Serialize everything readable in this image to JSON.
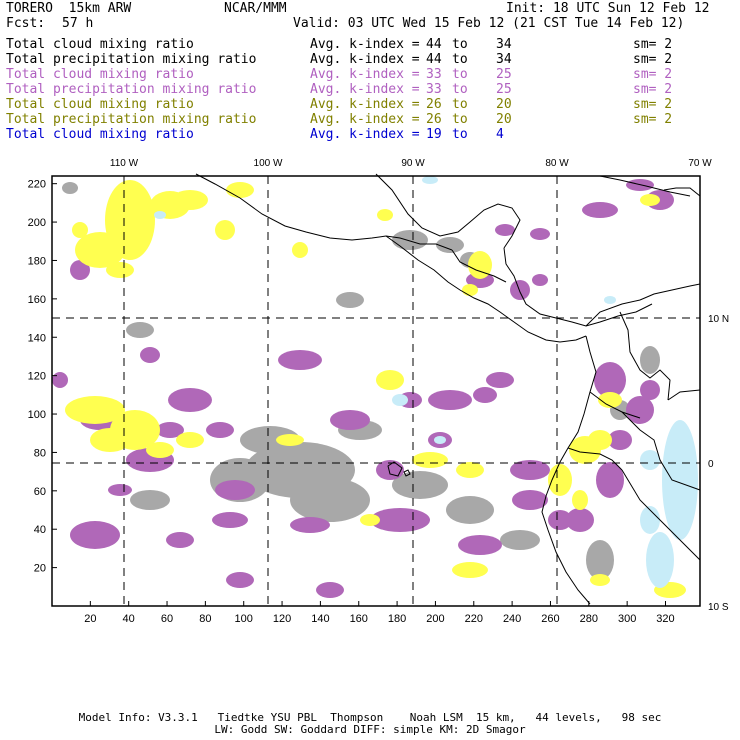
{
  "header": {
    "model": "TORERO  15km ARW",
    "center": "NCAR/MMM",
    "init": "Init: 18 UTC Sun 12 Feb 12",
    "fcst_label": "Fcst:",
    "fcst_value": "57 h",
    "valid": "Valid: 03 UTC Wed 15 Feb 12 (21 CST Tue 14 Feb 12)"
  },
  "legend": [
    {
      "field": "Total cloud mixing ratio",
      "kindex": "Avg. k-index =",
      "from": "44",
      "to_word": "to",
      "to": "34",
      "sm": "sm= 2",
      "color": "#000000"
    },
    {
      "field": "Total precipitation mixing ratio",
      "kindex": "Avg. k-index =",
      "from": "44",
      "to_word": "to",
      "to": "34",
      "sm": "sm= 2",
      "color": "#000000"
    },
    {
      "field": "Total cloud mixing ratio",
      "kindex": "Avg. k-index =",
      "from": "33",
      "to_word": "to",
      "to": "25",
      "sm": "sm= 2",
      "color": "#b060c0"
    },
    {
      "field": "Total precipitation mixing ratio",
      "kindex": "Avg. k-index =",
      "from": "33",
      "to_word": "to",
      "to": "25",
      "sm": "sm= 2",
      "color": "#b060c0"
    },
    {
      "field": "Total cloud mixing ratio",
      "kindex": "Avg. k-index =",
      "from": "26",
      "to_word": "to",
      "to": "20",
      "sm": "sm= 2",
      "color": "#808000"
    },
    {
      "field": "Total precipitation mixing ratio",
      "kindex": "Avg. k-index =",
      "from": "26",
      "to_word": "to",
      "to": "20",
      "sm": "sm= 2",
      "color": "#808000"
    },
    {
      "field": "Total cloud mixing ratio",
      "kindex": "Avg. k-index =",
      "from": "19",
      "to_word": "to",
      "to": "4",
      "sm": "",
      "color": "#0000d0"
    }
  ],
  "map": {
    "lon_labels": [
      "110 W",
      "100 W",
      "90 W",
      "80 W",
      "70 W"
    ],
    "lat_labels": [
      "10 N",
      "0",
      "10 S"
    ],
    "x_ticks": [
      "20",
      "40",
      "60",
      "80",
      "100",
      "120",
      "140",
      "160",
      "180",
      "200",
      "220",
      "240",
      "260",
      "280",
      "300",
      "320"
    ],
    "y_ticks": [
      "20",
      "40",
      "60",
      "80",
      "100",
      "120",
      "140",
      "160",
      "180",
      "200",
      "220"
    ],
    "fill_colors": {
      "gray": "#a8a8a8",
      "purple": "#b068b8",
      "yellow": "#ffff50",
      "lightblue": "#c8ecf8"
    }
  },
  "footer": {
    "line1": "Model Info: V3.3.1   Tiedtke YSU PBL  Thompson    Noah LSM  15 km,   44 levels,   98 sec",
    "line2": "LW: Godd SW: Goddard DIFF: simple KM: 2D Smagor"
  }
}
